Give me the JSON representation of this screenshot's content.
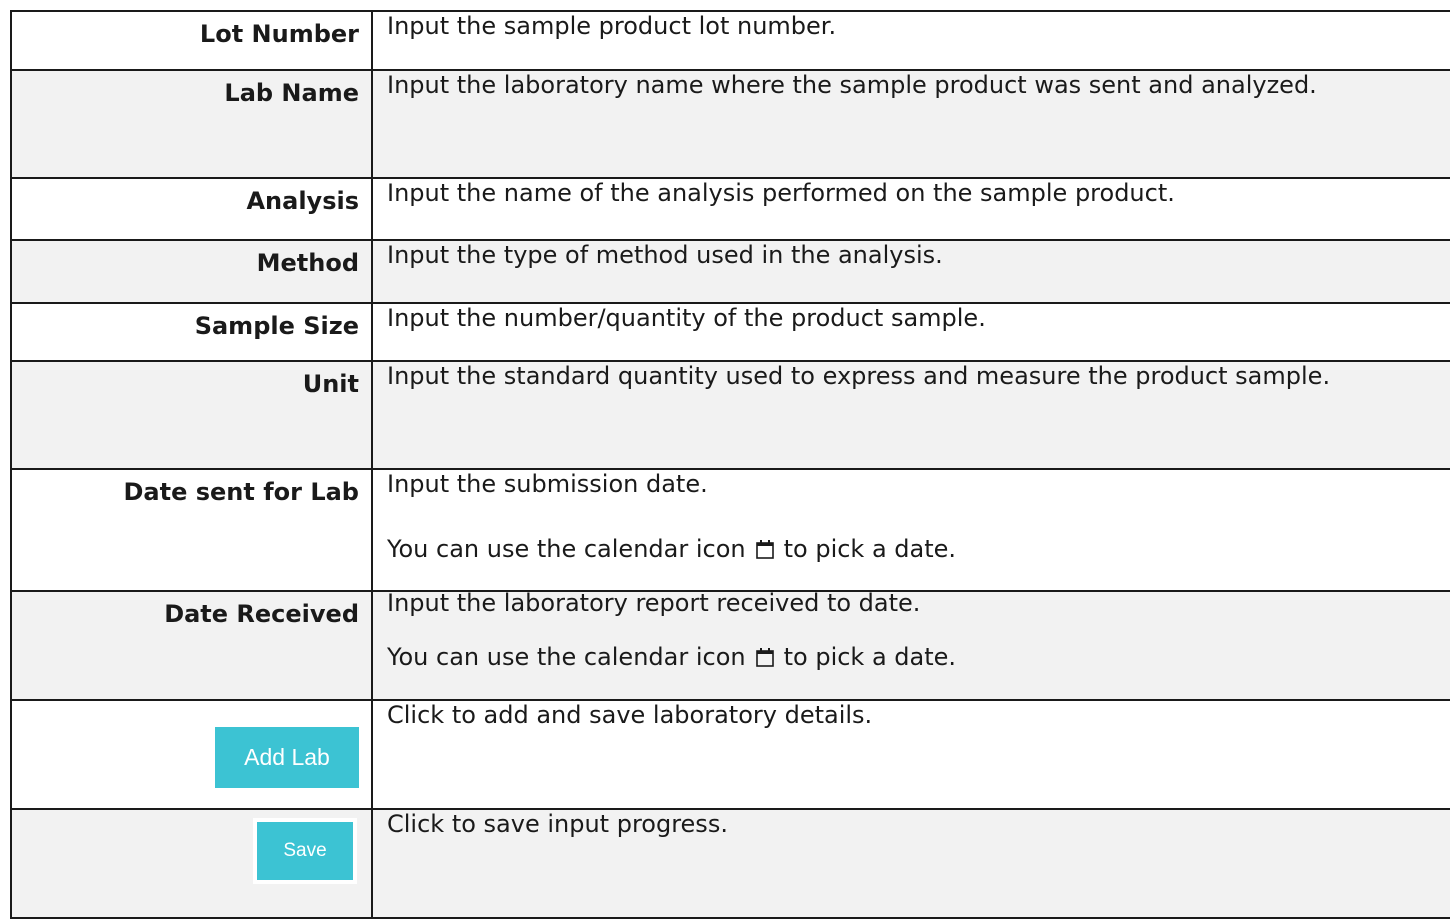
{
  "rows": [
    {
      "label": "Lot Number",
      "desc": [
        "Input the sample product lot number."
      ]
    },
    {
      "label": "Lab Name",
      "desc": [
        "Input the laboratory name where the sample product was sent and analyzed."
      ]
    },
    {
      "label": "Analysis",
      "desc": [
        "Input the name of the analysis performed on the sample product."
      ]
    },
    {
      "label": "Method",
      "desc": [
        "Input the type of method used in the analysis."
      ]
    },
    {
      "label": "Sample Size",
      "desc": [
        "Input the number/quantity of the product sample."
      ]
    },
    {
      "label": "Unit",
      "desc": [
        "Input the standard quantity used to express and measure the product sample."
      ]
    },
    {
      "label": "Date sent for Lab",
      "desc": [
        "Input the submission date."
      ],
      "calendar_before": "You can use the calendar icon",
      "calendar_after": "to pick a date."
    },
    {
      "label": "Date Received",
      "desc": [
        "Input the laboratory report received to date."
      ],
      "calendar_before": "You can use the calendar icon",
      "calendar_after": "to pick a date."
    },
    {
      "button": "Add Lab",
      "desc": [
        "Click to add and save laboratory details."
      ]
    },
    {
      "button": "Save",
      "desc": [
        "Click to save input progress."
      ]
    }
  ],
  "colors": {
    "button_bg": "#3cc3d3",
    "shade": "#f2f2f2",
    "border": "#1a1a1a"
  },
  "icons": {
    "calendar": "calendar-icon"
  }
}
